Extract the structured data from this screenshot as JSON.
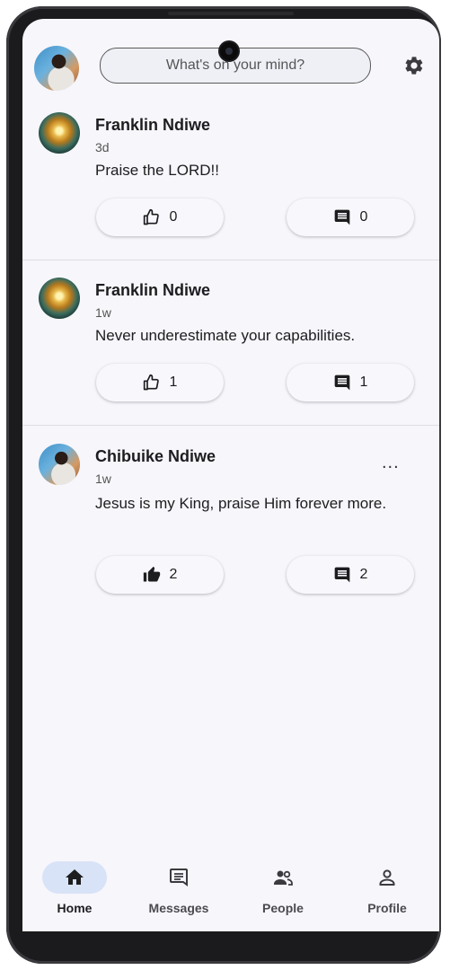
{
  "topbar": {
    "search_placeholder": "What's on your mind?",
    "icons": [
      "avatar",
      "gear-icon"
    ]
  },
  "posts": [
    {
      "author": "Franklin Ndiwe",
      "time": "3d",
      "text": "Praise the LORD!!",
      "likes": "0",
      "comments": "0",
      "liked": false,
      "has_menu": false
    },
    {
      "author": "Franklin Ndiwe",
      "time": "1w",
      "text": "Never underestimate your capabilities.",
      "likes": "1",
      "comments": "1",
      "liked": false,
      "has_menu": false
    },
    {
      "author": "Chibuike Ndiwe",
      "time": "1w",
      "text": "Jesus is my King, praise Him forever more.",
      "likes": "2",
      "comments": "2",
      "liked": true,
      "has_menu": true,
      "menu_label": "..."
    }
  ],
  "nav": {
    "items": [
      {
        "label": "Home",
        "icon": "home-icon",
        "active": true
      },
      {
        "label": "Messages",
        "icon": "message-icon",
        "active": false
      },
      {
        "label": "People",
        "icon": "people-icon",
        "active": false
      },
      {
        "label": "Profile",
        "icon": "person-icon",
        "active": false
      }
    ]
  },
  "colors": {
    "background": "#f6f6fb",
    "nav_active": "#d8e3f7",
    "text": "#1d1d1f"
  }
}
